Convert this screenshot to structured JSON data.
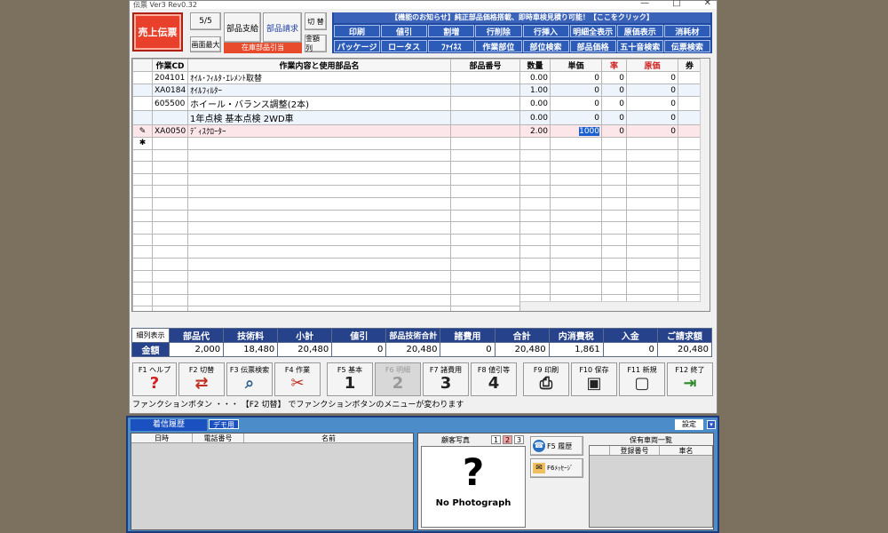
{
  "window": {
    "title": "伝票 Ver3 Rev0.32",
    "minimize": "—",
    "maximize": "□",
    "close": "✕"
  },
  "left": {
    "sales_slip": "売上伝票",
    "page": "5/5",
    "maximize": "画面最大",
    "parts_payment": "部品支給",
    "parts_request": "部品請求",
    "stock_parts": "在庫部品引当",
    "switch": "切 替",
    "amount_col": "金額列"
  },
  "notice": "【機能のお知らせ】純正部品価格搭載、即時車検見積り可能！【ここをクリック】",
  "toolbar_row1": [
    "印刷",
    "値引",
    "割増",
    "行削除",
    "行挿入",
    "明細全表示",
    "原価表示",
    "消耗材"
  ],
  "toolbar_row2": [
    "パッケージ",
    "ロータス",
    "ﾌｧｲﾈｽ",
    "作業部位",
    "部位検索",
    "部品価格",
    "五十音検索",
    "伝票検索"
  ],
  "grid": {
    "headers": [
      "",
      "作業CD",
      "作業内容と使用部品名",
      "部品番号",
      "数量",
      "単価",
      "率",
      "原価",
      "券"
    ],
    "rows": [
      {
        "mark": "",
        "cd": "204101",
        "name": "ｵｲﾙ･ﾌｨﾙﾀ･ｴﾚﾒﾝﾄ取替",
        "part": "",
        "qty": "0.00",
        "price": "0",
        "rate": "0",
        "cost": "0"
      },
      {
        "mark": "",
        "cd": "XA0184",
        "name": "ｵｲﾙﾌｨﾙﾀｰ",
        "part": "",
        "qty": "1.00",
        "price": "0",
        "rate": "0",
        "cost": "0"
      },
      {
        "mark": "",
        "cd": "605500",
        "name": "ホイール・バランス調整(2本)",
        "part": "",
        "qty": "0.00",
        "price": "0",
        "rate": "0",
        "cost": "0"
      },
      {
        "mark": "",
        "cd": "",
        "name": "1年点検 基本点検 2WD車",
        "part": "",
        "qty": "0.00",
        "price": "0",
        "rate": "0",
        "cost": "0"
      },
      {
        "mark": "✎",
        "cd": "XA0050",
        "name": "ﾃﾞｨｽｸﾛｰﾀｰ",
        "part": "",
        "qty": "2.00",
        "price": "1000",
        "rate": "0",
        "cost": "0"
      },
      {
        "mark": "✱",
        "cd": "",
        "name": "",
        "part": "",
        "qty": "",
        "price": "",
        "rate": "",
        "cost": ""
      }
    ]
  },
  "totals": {
    "detail": "細列表示",
    "amount": "金額",
    "headers": [
      "部品代",
      "技術料",
      "小計",
      "値引",
      "部品技術合計",
      "諸費用",
      "合計",
      "内消費税",
      "入金",
      "ご請求額"
    ],
    "values": [
      "2,000",
      "18,480",
      "20,480",
      "0",
      "20,480",
      "0",
      "20,480",
      "1,861",
      "0",
      "20,480"
    ]
  },
  "fkeys": [
    {
      "label": "F1 ヘルプ",
      "icon": "?"
    },
    {
      "label": "F2 切替",
      "icon": "⇄"
    },
    {
      "label": "F3 伝票検索",
      "icon": "⌕"
    },
    {
      "label": "F4 作業",
      "icon": "✂"
    },
    {
      "label": "F5 基本",
      "icon": "1"
    },
    {
      "label": "F6 明細",
      "icon": "2"
    },
    {
      "label": "F7 諸費用",
      "icon": "3"
    },
    {
      "label": "F8 値引等",
      "icon": "4"
    },
    {
      "label": "F9 印刷",
      "icon": "⎙"
    },
    {
      "label": "F10 保存",
      "icon": "▣"
    },
    {
      "label": "F11 新規",
      "icon": "▢"
    },
    {
      "label": "F12 終了",
      "icon": "⇥"
    }
  ],
  "status": "ファンクションボタン ・・・ 【F2 切替】 でファンクションボタンのメニューが変わります",
  "bottom": {
    "incoming_tab": "着信履歴",
    "demo_tab": "デモ用",
    "settings": "設定",
    "cols": [
      "日時",
      "電話番号",
      "名前"
    ],
    "customer_photo": "顧客写真",
    "photo_pages": [
      "1",
      "2",
      "3"
    ],
    "no_photo": "No Photograph",
    "f5_history": "F5 履歴",
    "f6_message": "F6ﾒｯｾｰｼﾞ",
    "vehicles_title": "保有車両一覧",
    "vehicle_cols": [
      "登録番号",
      "車名"
    ]
  }
}
